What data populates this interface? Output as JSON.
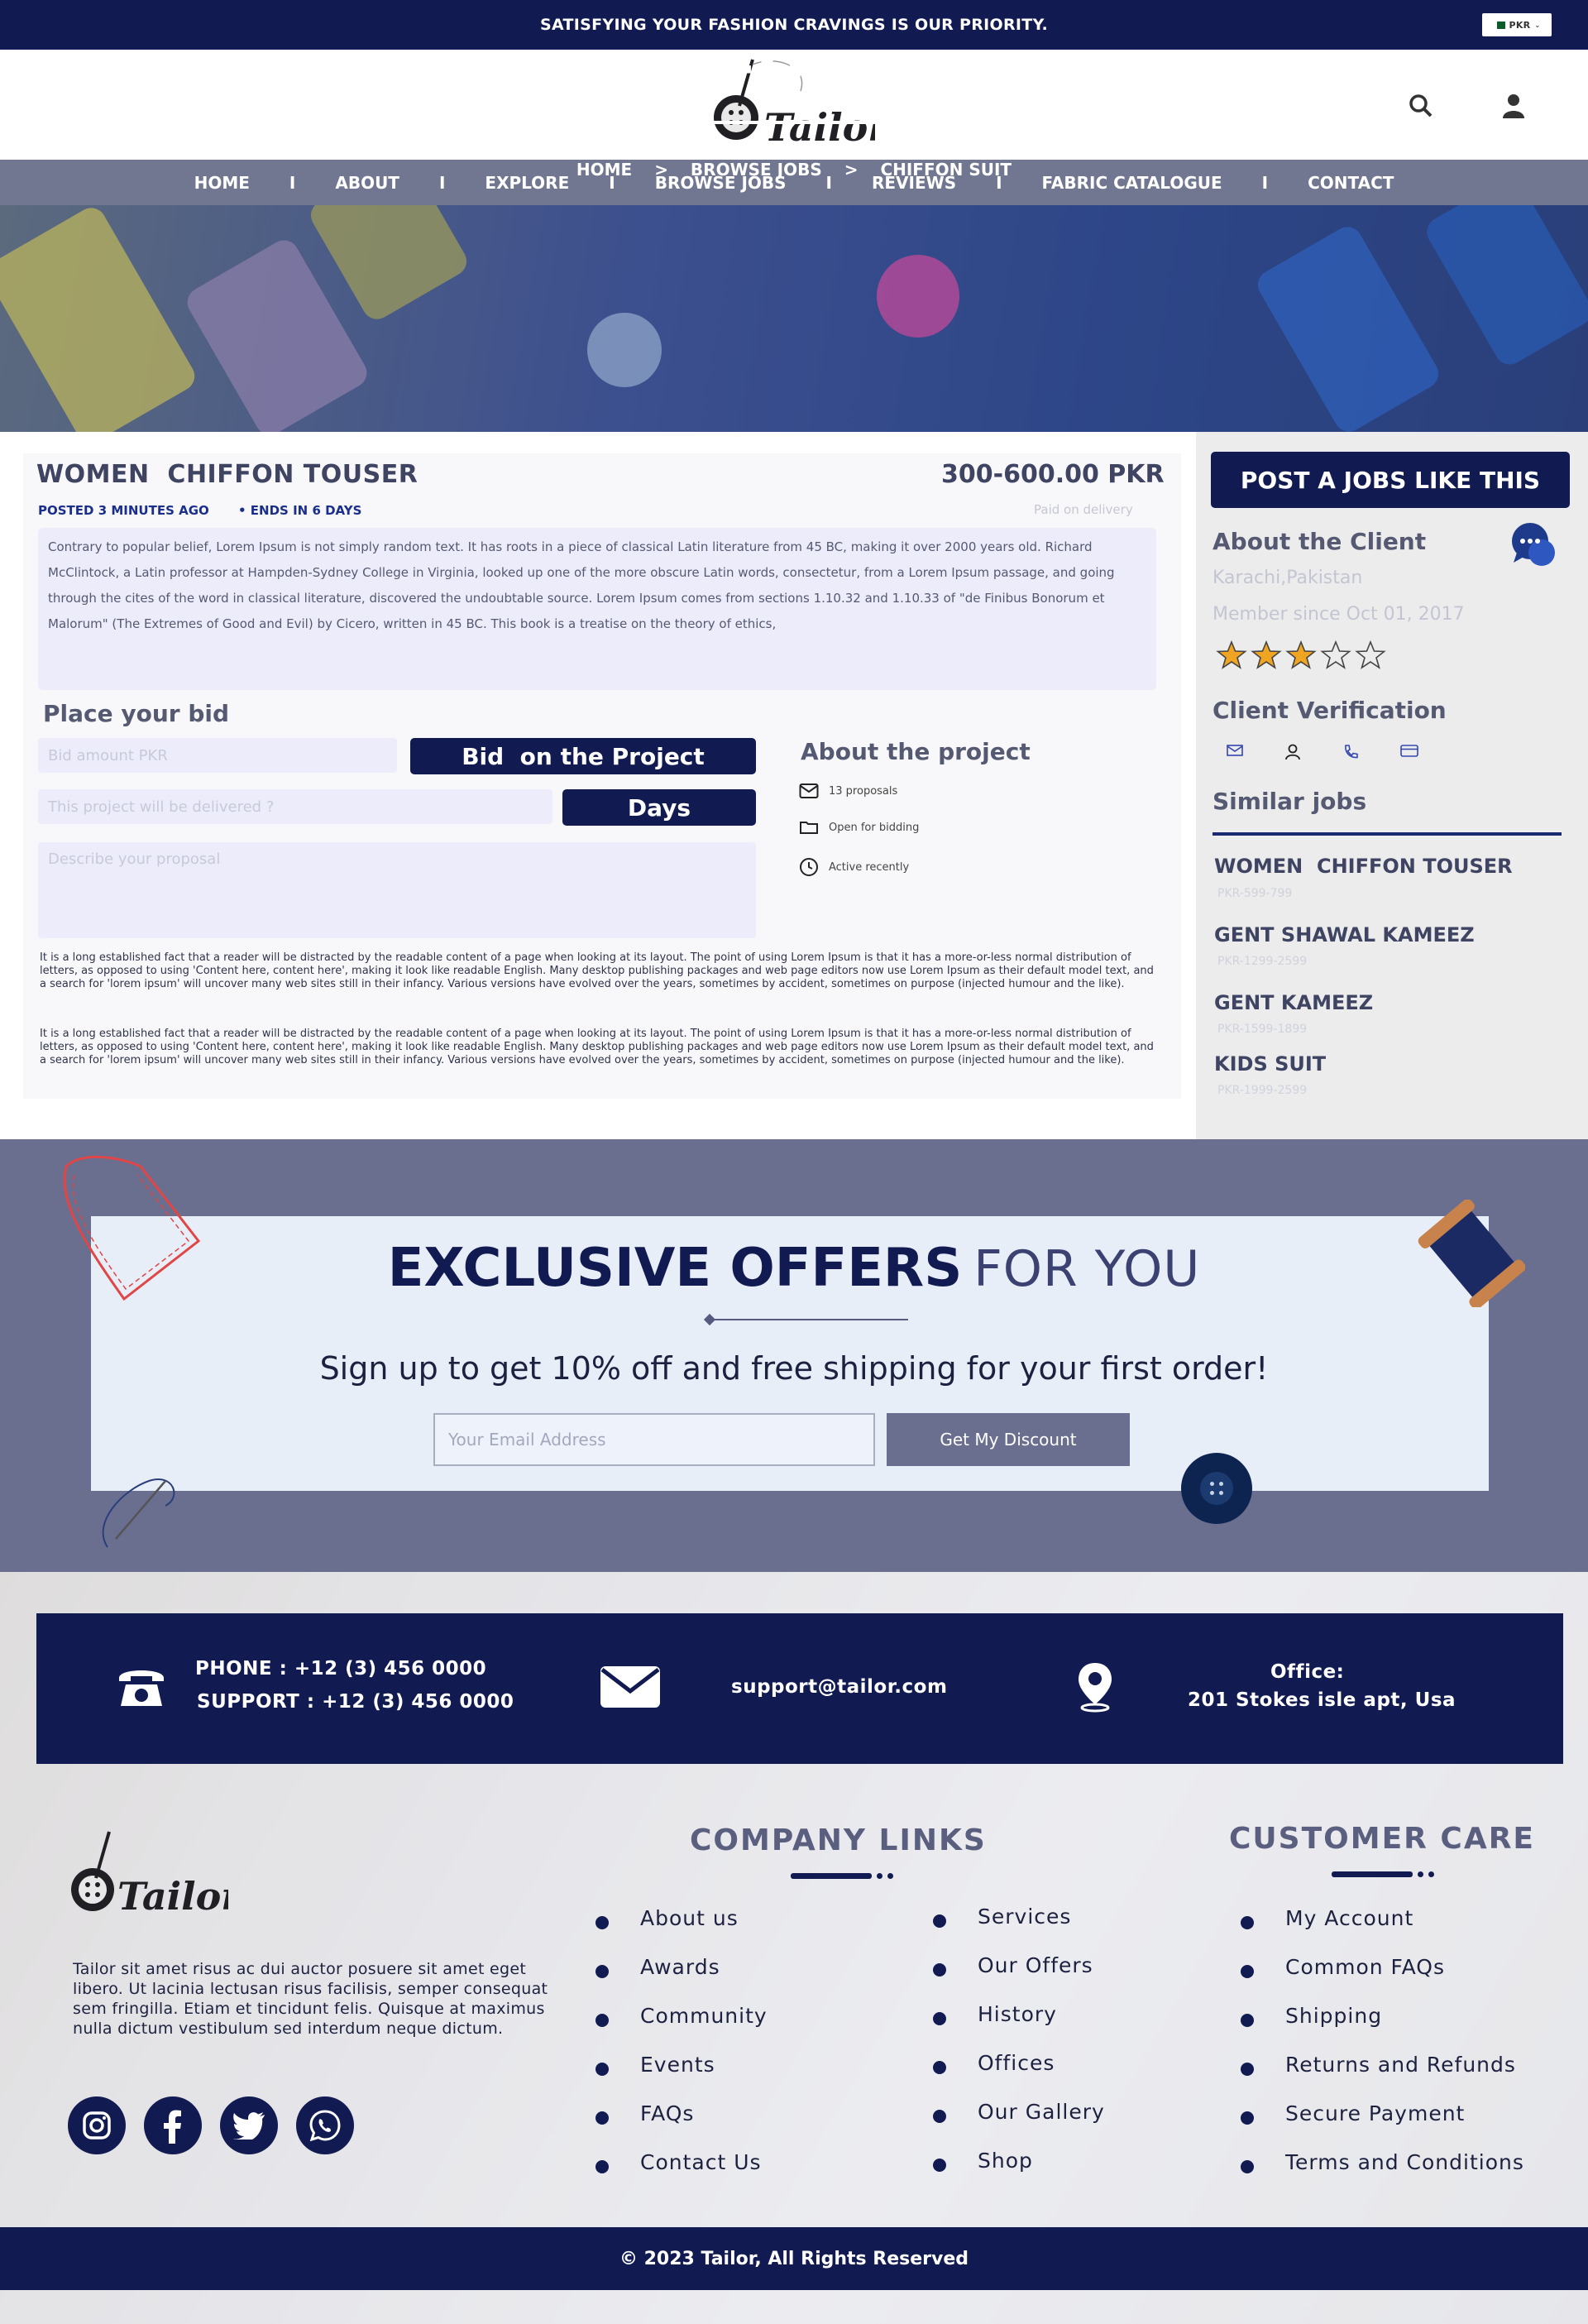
{
  "topbar": {
    "text": "SATISFYING YOUR FASHION CRAVINGS IS OUR PRIORITY.",
    "currency": "PKR"
  },
  "header": {
    "logo_text": "Tailor",
    "icons": [
      "search-icon",
      "user-icon"
    ]
  },
  "nav": {
    "items": [
      "HOME",
      "ABOUT",
      "EXPLORE",
      "BROWSE JOBS",
      "REVIEWS",
      "FABRIC CATALOGUE",
      "CONTACT"
    ],
    "separator": "I"
  },
  "hero": {
    "title": "CHIFFON SUIT",
    "breadcrumb": [
      "HOME",
      "BROWSE JOBS",
      "CHIFFON SUIT"
    ],
    "breadcrumb_sep": ">"
  },
  "job": {
    "title": "WOMEN  CHIFFON TOUSER",
    "price": "300-600.00 PKR",
    "posted": "POSTED 3 MINUTES AGO",
    "ends": "• ENDS IN 6 DAYS",
    "paid": "Paid  on delivery",
    "description": "Contrary to popular belief, Lorem Ipsum is not simply random text. It has roots in a piece of classical Latin literature from 45 BC, making it over 2000 years old. Richard McClintock, a Latin professor at Hampden-Sydney College in Virginia, looked up one of the more obscure Latin words, consectetur, from a Lorem Ipsum passage, and going through the cites of the word in classical literature, discovered the undoubtable source. Lorem Ipsum comes from sections 1.10.32 and 1.10.33 of \"de Finibus Bonorum et Malorum\" (The Extremes of Good and Evil) by Cicero, written in 45 BC. This book is a treatise on the theory of ethics,"
  },
  "bid": {
    "heading": "Place your bid",
    "amount_placeholder": "Bid amount PKR",
    "bid_button": "Bid  on the Project",
    "delivery_placeholder": "This project will be delivered ?",
    "days_button": "Days",
    "proposal_placeholder": "Describe your proposal"
  },
  "about_project": {
    "heading": "About the project",
    "items": [
      {
        "icon": "envelope-icon",
        "text": "13 proposals"
      },
      {
        "icon": "folder-icon",
        "text": "Open for bidding"
      },
      {
        "icon": "clock-icon",
        "text": "Active recently"
      }
    ]
  },
  "lorem": [
    "It is a long established fact that a reader will be distracted by the readable content of a page when looking at its layout. The point of using Lorem Ipsum is that it has a more-or-less normal distribution of letters, as opposed to using 'Content here, content here', making it look like readable English. Many desktop publishing packages and web page editors now use Lorem Ipsum as their default model text, and a search for 'lorem ipsum' will uncover many web sites still in their infancy. Various versions have evolved over the years, sometimes by accident, sometimes on purpose (injected humour and the like).",
    "It is a long established fact that a reader will be distracted by the readable content of a page when looking at its layout. The point of using Lorem Ipsum is that it has a more-or-less normal distribution of letters, as opposed to using 'Content here, content here', making it look like readable English. Many desktop publishing packages and web page editors now use Lorem Ipsum as their default model text, and a search for 'lorem ipsum' will uncover many web sites still in their infancy. Various versions have evolved over the years, sometimes by accident, sometimes on purpose (injected humour and the like)."
  ],
  "sidebar": {
    "post_button": "POST A JOBS LIKE THIS",
    "about_client": "About the Client",
    "location": "Karachi,Pakistan",
    "member_since": "Member since Oct 01, 2017",
    "rating": 3,
    "rating_max": 5,
    "verification_heading": "Client Verification",
    "verification_icons": [
      "email-icon",
      "user-icon",
      "phone-icon",
      "card-icon"
    ],
    "similar_heading": "Similar jobs",
    "similar_jobs": [
      {
        "title": "WOMEN  CHIFFON TOUSER",
        "price": "PKR-599-799"
      },
      {
        "title": "GENT SHAWAL KAMEEZ",
        "price": "PKR-1299-2599"
      },
      {
        "title": "GENT KAMEEZ",
        "price": "PKR-1599-1899"
      },
      {
        "title": "KIDS SUIT",
        "price": "PKR-1999-2599"
      }
    ]
  },
  "offers": {
    "title_bold": "EXCLUSIVE OFFERS",
    "title_light": "FOR YOU",
    "subtitle": "Sign up to get 10% off and free shipping for your first order!",
    "email_placeholder": "Your Email Address",
    "button": "Get My Discount"
  },
  "contact": {
    "phone": "PHONE : +12 (3) 456 0000",
    "support": "SUPPORT : +12 (3) 456 0000",
    "email": "support@tailor.com",
    "office_label": "Office:",
    "office_address": "201 Stokes isle apt, Usa"
  },
  "footer": {
    "about": "Tailor sit amet risus ac dui auctor posuere sit amet eget libero. Ut lacinia lectusan risus facilisis, semper consequat sem fringilla. Etiam et tincidunt felis. Quisque at maximus nulla dictum vestibulum sed interdum neque dictum.",
    "socials": [
      "instagram-icon",
      "facebook-icon",
      "twitter-icon",
      "whatsapp-icon"
    ],
    "company_heading": "COMPANY LINKS",
    "company_col1": [
      "About us",
      "Awards",
      "Community",
      "Events",
      "FAQs",
      "Contact Us"
    ],
    "company_col2": [
      "Services",
      "Our Offers",
      "History",
      "Offices",
      "Our Gallery",
      "Shop"
    ],
    "care_heading": "CUSTOMER CARE",
    "care_links": [
      "My Account",
      "Common FAQs",
      "Shipping",
      "Returns and Refunds",
      "Secure Payment",
      "Terms and Conditions"
    ],
    "copyright": "© 2023 Tailor, All Rights Reserved"
  },
  "colors": {
    "navy": "#111b51",
    "nav_gray": "#717790",
    "offers_bg": "#6a6f90",
    "star": "#f0a522"
  }
}
